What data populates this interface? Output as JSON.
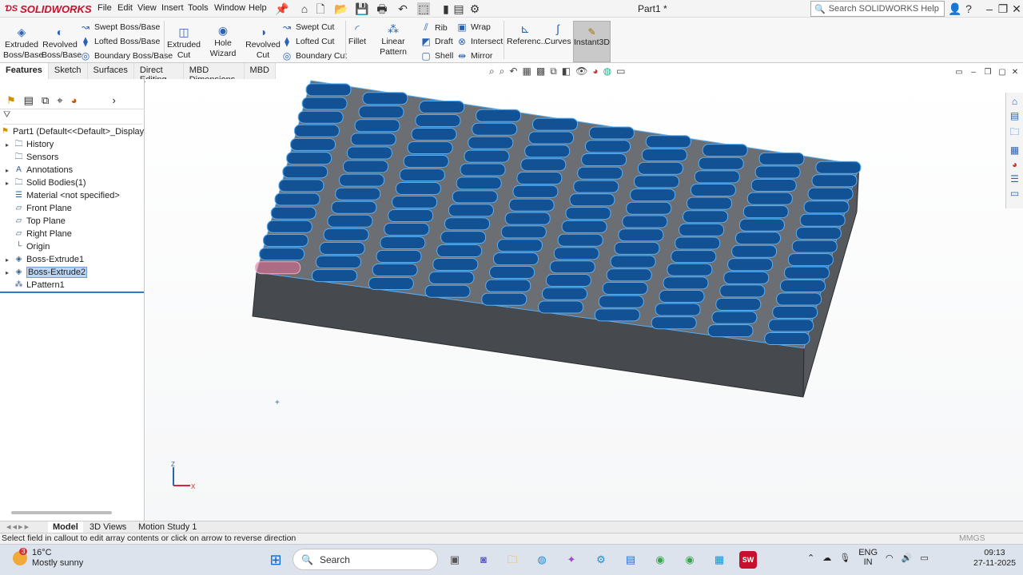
{
  "app": {
    "name": "SOLIDWORKS",
    "doc_title": "Part1 *"
  },
  "menu": [
    "File",
    "Edit",
    "View",
    "Insert",
    "Tools",
    "Window",
    "Help"
  ],
  "search": {
    "placeholder": "Search SOLIDWORKS Help"
  },
  "ribbon": {
    "extruded_boss": "Extruded\nBoss/Base",
    "revolved_boss": "Revolved\nBoss/Base",
    "swept_boss": "Swept Boss/Base",
    "lofted_boss": "Lofted Boss/Base",
    "boundary_boss": "Boundary Boss/Base",
    "extruded_cut": "Extruded\nCut",
    "hole_wizard": "Hole Wizard",
    "revolved_cut": "Revolved\nCut",
    "swept_cut": "Swept Cut",
    "lofted_cut": "Lofted Cut",
    "boundary_cut": "Boundary Cut",
    "fillet": "Fillet",
    "linear_pattern": "Linear Pattern",
    "rib": "Rib",
    "draft": "Draft",
    "shell": "Shell",
    "wrap": "Wrap",
    "intersect": "Intersect",
    "mirror": "Mirror",
    "reference": "Referenc...",
    "curves": "Curves",
    "instant3d": "Instant3D"
  },
  "command_tabs": [
    "Features",
    "Sketch",
    "Surfaces",
    "Direct Editing",
    "MBD Dimensions",
    "MBD"
  ],
  "tree": [
    {
      "label": "Part1  (Default<<Default>_Display S",
      "icon": "part-icon",
      "arrow": false
    },
    {
      "label": "History",
      "icon": "history-folder-icon",
      "arrow": true
    },
    {
      "label": "Sensors",
      "icon": "sensors-folder-icon",
      "arrow": false
    },
    {
      "label": "Annotations",
      "icon": "annotations-icon",
      "arrow": true
    },
    {
      "label": "Solid Bodies(1)",
      "icon": "solid-bodies-icon",
      "arrow": true
    },
    {
      "label": "Material <not specified>",
      "icon": "material-icon",
      "arrow": false
    },
    {
      "label": "Front Plane",
      "icon": "plane-icon",
      "arrow": false
    },
    {
      "label": "Top Plane",
      "icon": "plane-icon",
      "arrow": false
    },
    {
      "label": "Right Plane",
      "icon": "plane-icon",
      "arrow": false
    },
    {
      "label": "Origin",
      "icon": "origin-icon",
      "arrow": false
    },
    {
      "label": "Boss-Extrude1",
      "icon": "extrude-icon",
      "arrow": true
    },
    {
      "label": "Boss-Extrude2",
      "icon": "extrude-icon",
      "arrow": true,
      "selected": true
    },
    {
      "label": "LPattern1",
      "icon": "linear-pattern-icon",
      "arrow": false
    }
  ],
  "bottom_tabs": [
    "Model",
    "3D Views",
    "Motion Study 1"
  ],
  "status": {
    "message": "Select field in callout to edit array contents or click on arrow to reverse direction",
    "units": "MMGS"
  },
  "triad": {
    "z": "Z",
    "x": "X"
  },
  "taskbar": {
    "temp": "16°C",
    "weather": "Mostly sunny",
    "badge": "3",
    "search_label": "Search",
    "lang": "ENG",
    "region": "IN",
    "time": "09:13",
    "date": "27-11-2025"
  },
  "colors": {
    "body": "#4a4d52",
    "pattern_blue": "#0d4f96",
    "edge_blue": "#5aaef2",
    "seed_pink": "#e36b8f"
  }
}
